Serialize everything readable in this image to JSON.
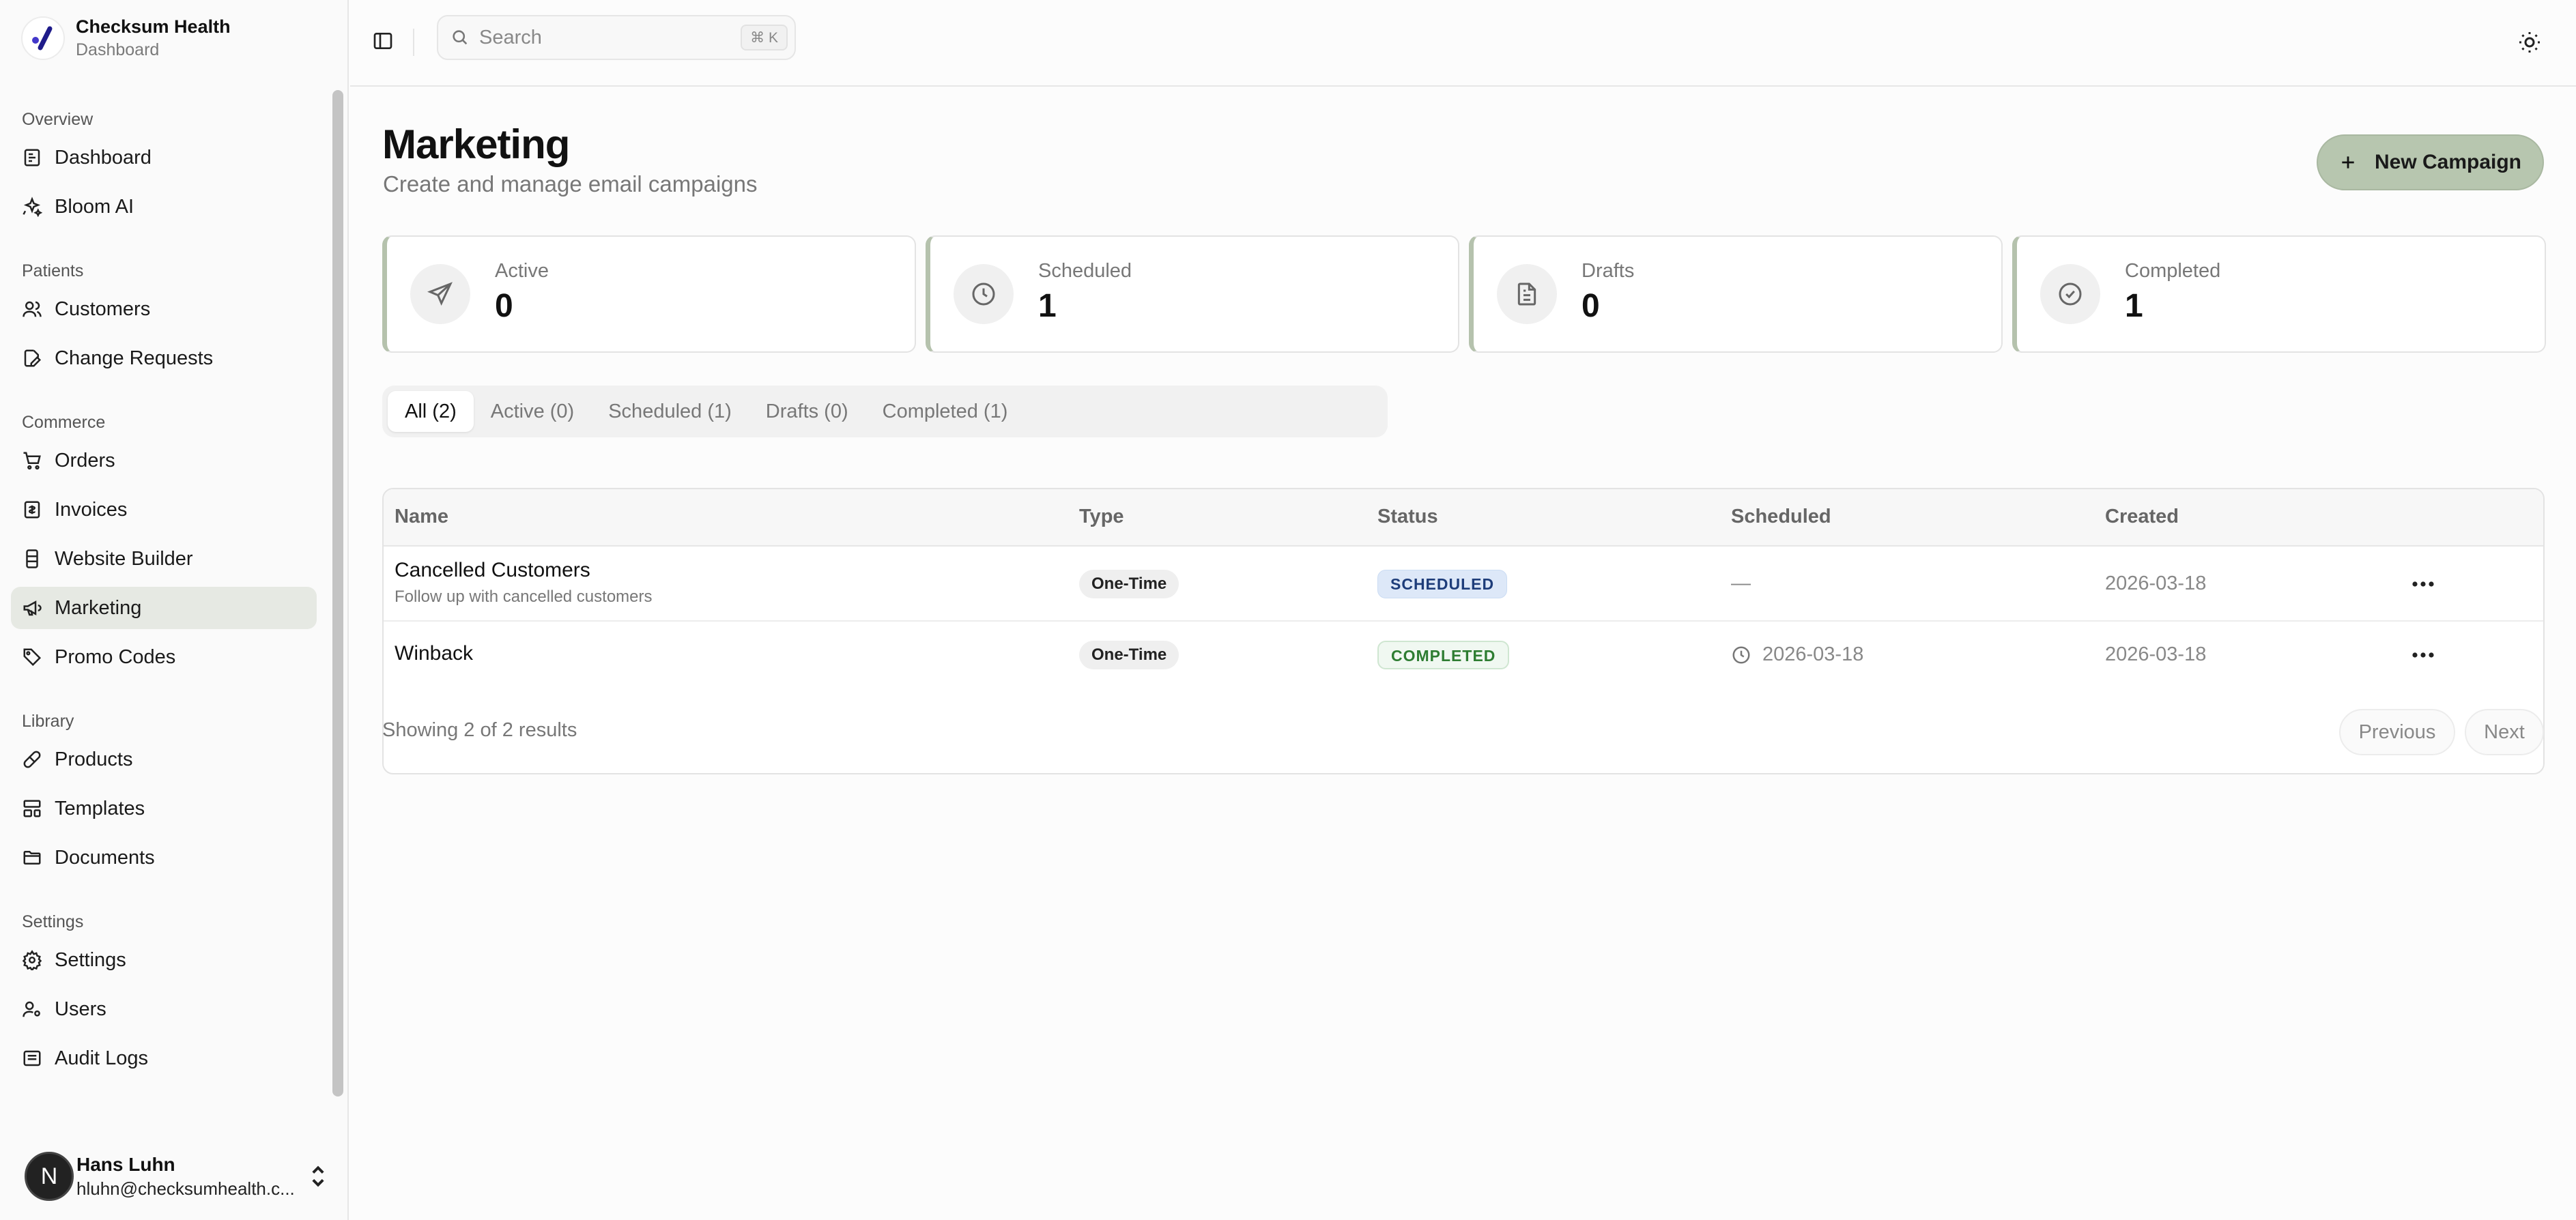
{
  "brand": {
    "name": "Checksum Health",
    "subtitle": "Dashboard"
  },
  "sidebar": {
    "groups": [
      {
        "title": "Overview",
        "items": [
          {
            "label": "Dashboard",
            "icon": "dashboard-icon"
          },
          {
            "label": "Bloom AI",
            "icon": "sparkles-icon"
          }
        ]
      },
      {
        "title": "Patients",
        "items": [
          {
            "label": "Customers",
            "icon": "users-icon"
          },
          {
            "label": "Change Requests",
            "icon": "file-edit-icon"
          }
        ]
      },
      {
        "title": "Commerce",
        "items": [
          {
            "label": "Orders",
            "icon": "cart-icon"
          },
          {
            "label": "Invoices",
            "icon": "receipt-icon"
          },
          {
            "label": "Website Builder",
            "icon": "builder-icon"
          },
          {
            "label": "Marketing",
            "icon": "megaphone-icon",
            "active": true
          },
          {
            "label": "Promo Codes",
            "icon": "tag-icon"
          }
        ]
      },
      {
        "title": "Library",
        "items": [
          {
            "label": "Products",
            "icon": "pill-icon"
          },
          {
            "label": "Templates",
            "icon": "template-icon"
          },
          {
            "label": "Documents",
            "icon": "folder-icon"
          }
        ]
      },
      {
        "title": "Settings",
        "items": [
          {
            "label": "Settings",
            "icon": "gear-icon"
          },
          {
            "label": "Users",
            "icon": "user-key-icon"
          },
          {
            "label": "Audit Logs",
            "icon": "log-icon"
          }
        ]
      }
    ]
  },
  "user": {
    "initial": "N",
    "name": "Hans Luhn",
    "email": "hluhn@checksumhealth.c..."
  },
  "topbar": {
    "search_placeholder": "Search",
    "shortcut": "⌘ K"
  },
  "page": {
    "title": "Marketing",
    "subtitle": "Create and manage email campaigns",
    "new_button": "New Campaign"
  },
  "stats": [
    {
      "label": "Active",
      "value": "0",
      "icon": "send-icon"
    },
    {
      "label": "Scheduled",
      "value": "1",
      "icon": "clock-icon"
    },
    {
      "label": "Drafts",
      "value": "0",
      "icon": "document-icon"
    },
    {
      "label": "Completed",
      "value": "1",
      "icon": "check-circle-icon"
    }
  ],
  "tabs": [
    "All (2)",
    "Active (0)",
    "Scheduled (1)",
    "Drafts (0)",
    "Completed (1)"
  ],
  "table": {
    "headers": [
      "Name",
      "Type",
      "Status",
      "Scheduled",
      "Created"
    ],
    "rows": [
      {
        "name": "Cancelled Customers",
        "description": "Follow up with cancelled customers",
        "type": "One-Time",
        "status": "SCHEDULED",
        "scheduled": "—",
        "created": "2026-03-18"
      },
      {
        "name": "Winback",
        "description": "",
        "type": "One-Time",
        "status": "COMPLETED",
        "scheduled": "2026-03-18",
        "created": "2026-03-18"
      }
    ]
  },
  "footer": {
    "summary": "Showing 2 of 2 results",
    "previous": "Previous",
    "next": "Next"
  },
  "colors": {
    "accent": "#b7c6af",
    "active_nav": "#e6e9e3",
    "scheduled_badge": "#dde8f8",
    "completed_badge": "#2e7d32"
  }
}
